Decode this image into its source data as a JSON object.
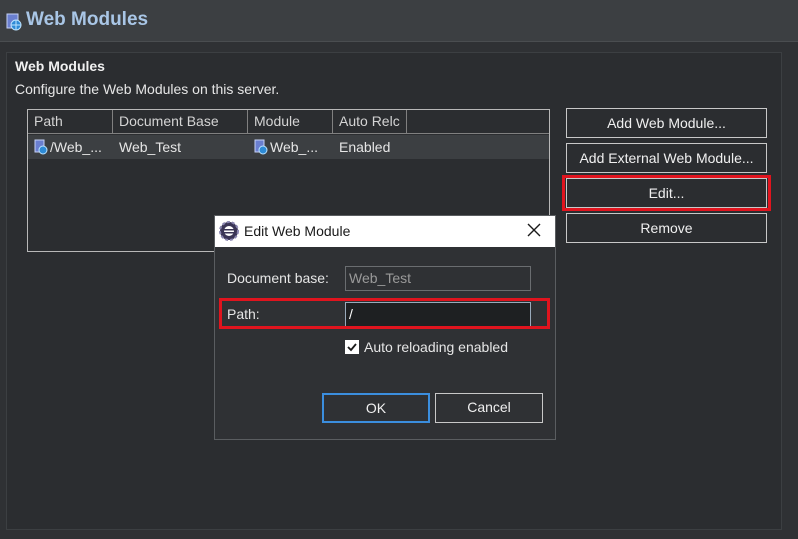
{
  "editor": {
    "title": "Web Modules",
    "title_icon": "web-modules-icon"
  },
  "section": {
    "header": "Web Modules",
    "description": "Configure the Web Modules on this server."
  },
  "table": {
    "columns": [
      "Path",
      "Document Base",
      "Module",
      "Auto Relc"
    ],
    "rows": [
      {
        "path": "/Web_...",
        "document_base": "Web_Test",
        "module": "Web_...",
        "auto_reload": "Enabled",
        "path_icon": "web-module-icon",
        "module_icon": "web-module-icon"
      }
    ]
  },
  "buttons": {
    "add_web_module": "Add Web Module...",
    "add_external": "Add External Web Module...",
    "edit": "Edit...",
    "remove": "Remove"
  },
  "dialog": {
    "title": "Edit Web Module",
    "icon": "eclipse-icon",
    "document_base_label": "Document base:",
    "document_base_value": "Web_Test",
    "path_label": "Path:",
    "path_value": "/",
    "auto_reload_label": "Auto reloading enabled",
    "auto_reload_checked": true,
    "ok_label": "OK",
    "cancel_label": "Cancel"
  },
  "colors": {
    "highlight": "#e0141e",
    "title_accent": "#a9c6e6"
  }
}
